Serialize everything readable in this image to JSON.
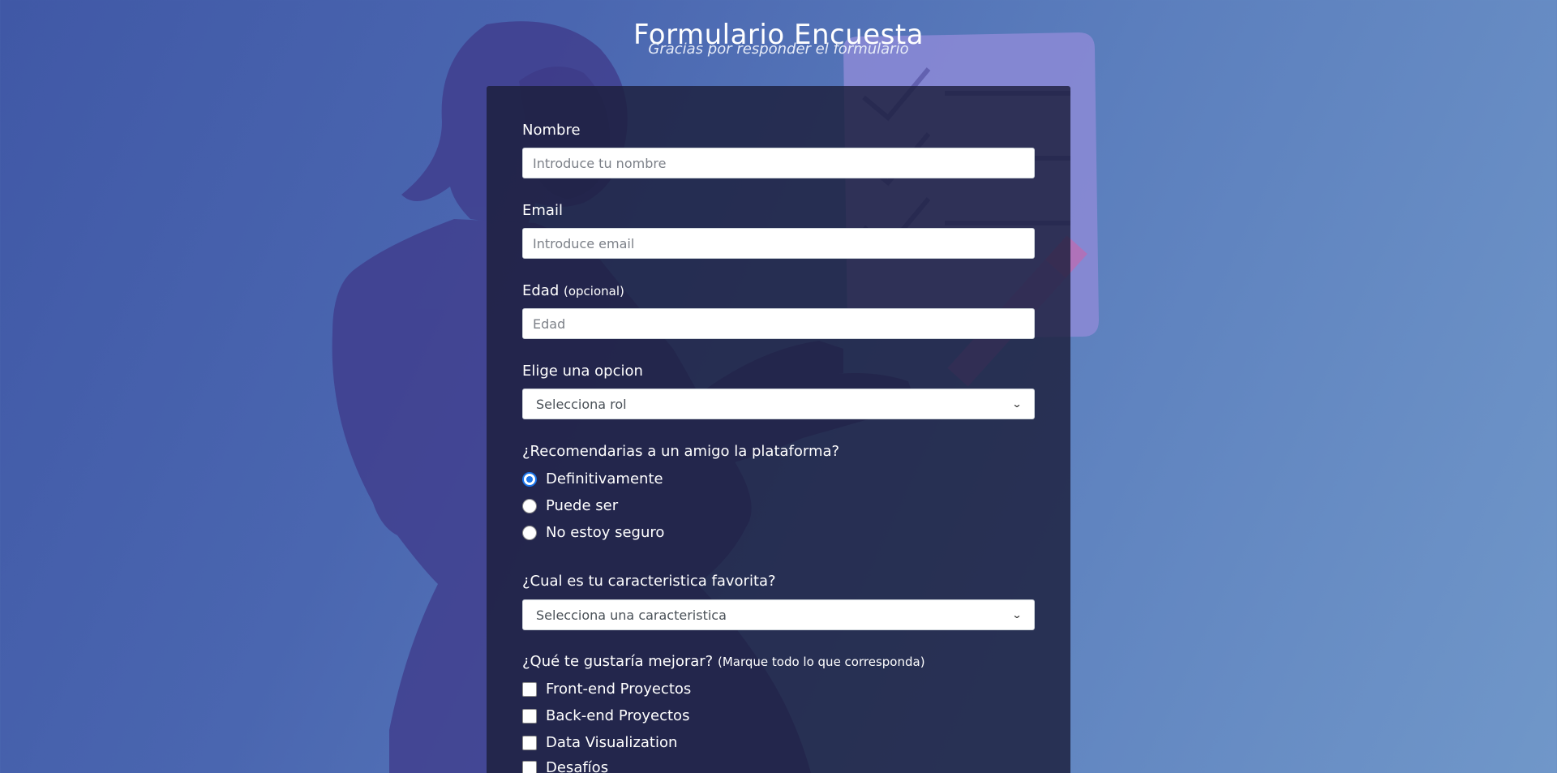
{
  "header": {
    "title": "Formulario Encuesta",
    "subtitle": "Gracias por responder el formulario"
  },
  "form": {
    "name": {
      "label": "Nombre",
      "placeholder": "Introduce tu nombre",
      "value": ""
    },
    "email": {
      "label": "Email",
      "placeholder": "Introduce email",
      "value": ""
    },
    "age": {
      "label": "Edad",
      "label_note": "(opcional)",
      "placeholder": "Edad",
      "value": ""
    },
    "role": {
      "label": "Elige una opcion",
      "selected": "Selecciona rol"
    },
    "recommend": {
      "label": "¿Recomendarias a un amigo la plataforma?",
      "options": [
        {
          "label": "Definitivamente",
          "checked": true
        },
        {
          "label": "Puede ser",
          "checked": false
        },
        {
          "label": "No estoy seguro",
          "checked": false
        }
      ]
    },
    "favorite": {
      "label": "¿Cual es tu caracteristica favorita?",
      "selected": "Selecciona una caracteristica"
    },
    "improve": {
      "label": "¿Qué te gustaría mejorar?",
      "label_note": "(Marque todo lo que corresponda)",
      "options": [
        {
          "label": "Front-end Proyectos",
          "checked": false
        },
        {
          "label": "Back-end Proyectos",
          "checked": false
        },
        {
          "label": "Data Visualization",
          "checked": false
        },
        {
          "label": "Desafíos",
          "checked": false
        }
      ]
    }
  },
  "colors": {
    "accent": "#1a73e8",
    "card_background": "#1c1e3c"
  }
}
